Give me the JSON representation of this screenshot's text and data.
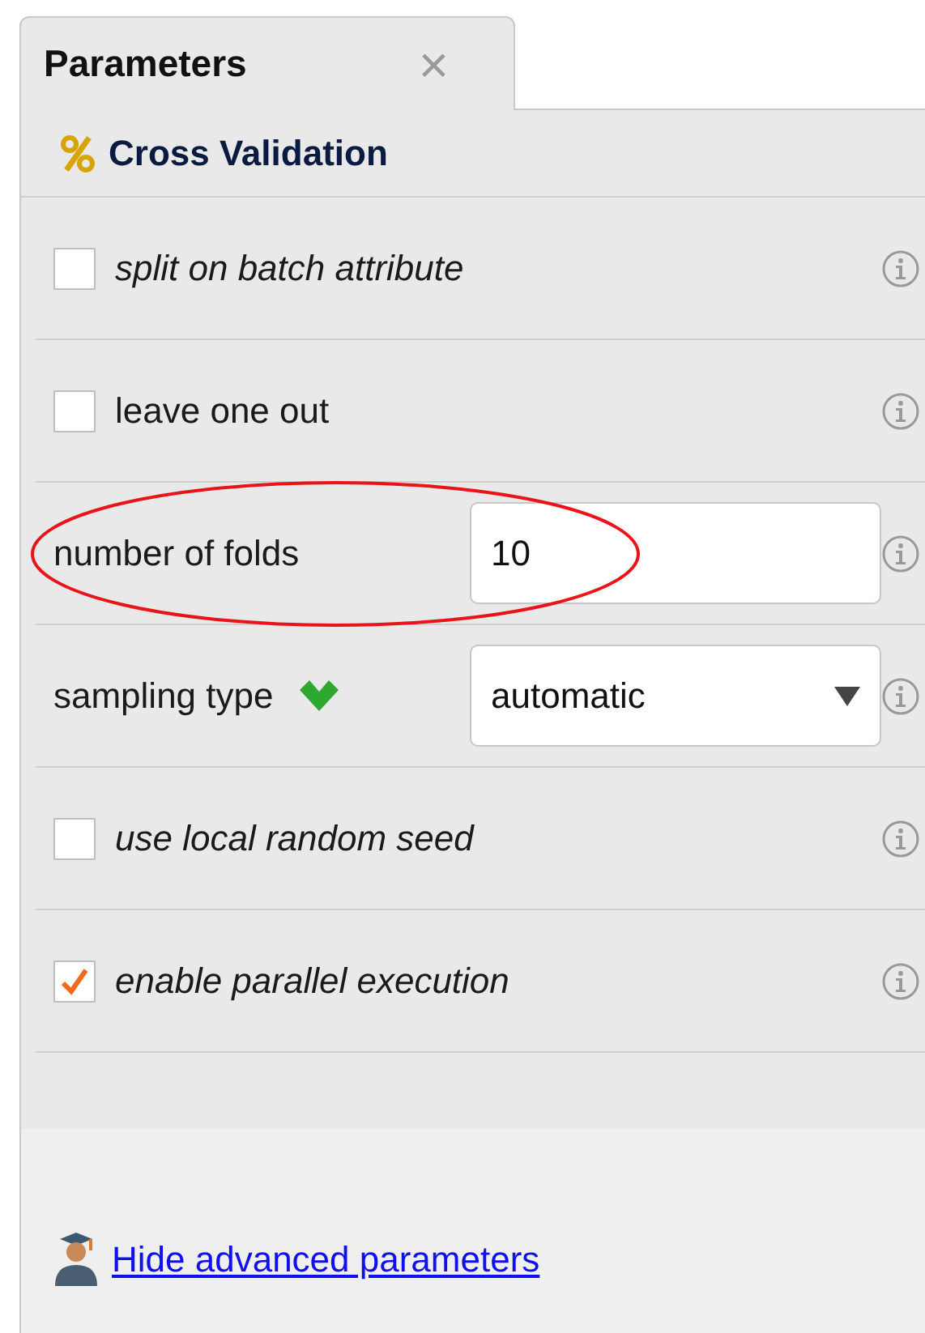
{
  "tab": {
    "label": "Parameters",
    "close": "×"
  },
  "operator": {
    "name": "Cross Validation"
  },
  "parameters": [
    {
      "kind": "checkbox",
      "label": "split on batch attribute",
      "expert": true,
      "checked": false
    },
    {
      "kind": "checkbox",
      "label": "leave one out",
      "expert": false,
      "checked": false
    },
    {
      "kind": "number",
      "label": "number of folds",
      "expert": false,
      "value": "10",
      "highlighted": true
    },
    {
      "kind": "select",
      "label": "sampling type",
      "expert": false,
      "value": "automatic",
      "confirmed": true
    },
    {
      "kind": "checkbox",
      "label": "use local random seed",
      "expert": true,
      "checked": false
    },
    {
      "kind": "checkbox",
      "label": "enable parallel execution",
      "expert": true,
      "checked": true
    }
  ],
  "footer": {
    "link": "Hide advanced parameters"
  }
}
